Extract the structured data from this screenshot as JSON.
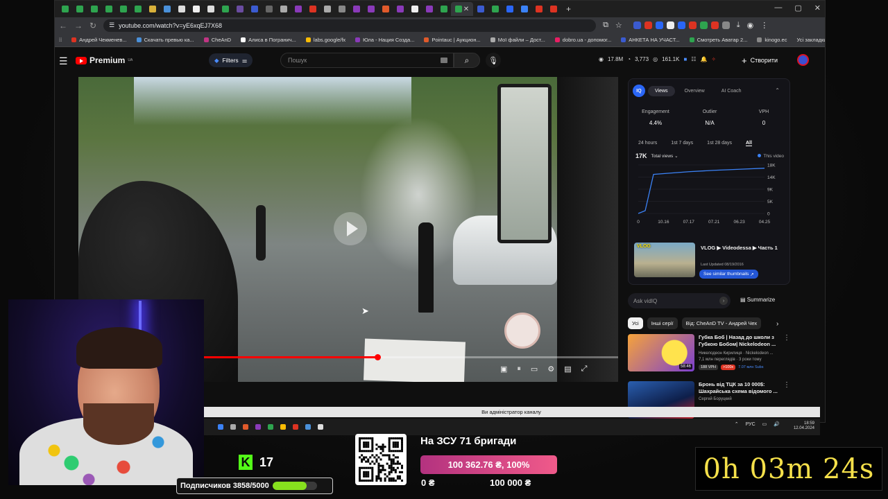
{
  "browser": {
    "url": "youtube.com/watch?v=yE6xqEJ7X68",
    "tabs": [
      {
        "color": "#2ea44f"
      },
      {
        "color": "#2ea44f"
      },
      {
        "color": "#2ea44f"
      },
      {
        "color": "#2ea44f"
      },
      {
        "color": "#2ea44f"
      },
      {
        "color": "#2ea44f"
      },
      {
        "color": "#d9b13a"
      },
      {
        "color": "#4a90d9"
      },
      {
        "color": "#ddd"
      },
      {
        "color": "#eee"
      },
      {
        "color": "#ddd"
      },
      {
        "color": "#2ea44f"
      },
      {
        "color": "#6a4ca0"
      },
      {
        "color": "#3b5bd0"
      },
      {
        "color": "#666"
      },
      {
        "color": "#aaa"
      },
      {
        "color": "#8a3ab9"
      },
      {
        "color": "#d32"
      },
      {
        "color": "#aaa"
      },
      {
        "color": "#888"
      },
      {
        "color": "#8a3ab9"
      },
      {
        "color": "#8a3ab9"
      },
      {
        "color": "#e05a2b"
      },
      {
        "color": "#8a3ab9"
      },
      {
        "color": "#eee"
      },
      {
        "color": "#8a3ab9"
      },
      {
        "color": "#2ea44f"
      },
      {
        "color": "#2ea44f"
      },
      {
        "color": "#3b5bd0"
      },
      {
        "color": "#2ea44f"
      },
      {
        "color": "#2a66f7"
      },
      {
        "color": "#3b82f6"
      },
      {
        "color": "#d32"
      },
      {
        "color": "#d32"
      }
    ],
    "bookmarks": [
      {
        "label": "Андрей Чекменев...",
        "color": "#d32"
      },
      {
        "label": "Скачать превью ка...",
        "color": "#4a90d9"
      },
      {
        "label": "CheAnD",
        "color": "#c13584"
      },
      {
        "label": "Алиса в Погранич...",
        "color": "#fff"
      },
      {
        "label": "labs.google/fx",
        "color": "#fbbc04"
      },
      {
        "label": "Юла - Нация Созда...",
        "color": "#8a3ab9"
      },
      {
        "label": "Pointauc | Аукцион...",
        "color": "#e05a2b"
      },
      {
        "label": "Мої файли – Дост...",
        "color": "#aaa"
      },
      {
        "label": "dobro.ua - допомог...",
        "color": "#e91e63"
      },
      {
        "label": "АНКЕТА НА УЧАСТ...",
        "color": "#3b5bd0"
      },
      {
        "label": "Смотреть Аватар 2...",
        "color": "#2ea44f"
      },
      {
        "label": "kinogo.ec",
        "color": "#888"
      }
    ],
    "all_bookmarks": "Усі закладки"
  },
  "youtube": {
    "logo_text": "Premium",
    "logo_region": "UA",
    "filters_label": "Filters",
    "search_placeholder": "Пошук",
    "stats": {
      "views": "17.8M",
      "likes": "3,773",
      "subs": "161.1K"
    },
    "create_label": "Створити"
  },
  "player": {
    "progress": 0.42
  },
  "vidiq": {
    "tabs": [
      "Views",
      "Overview",
      "AI Coach"
    ],
    "active_tab": "Views",
    "metrics": [
      {
        "label": "Engagement",
        "value": "4.4%"
      },
      {
        "label": "Outlier",
        "value": "N/A"
      },
      {
        "label": "VPH",
        "value": "0"
      }
    ],
    "ranges": [
      "24 hours",
      "1st 7 days",
      "1st 28 days",
      "All"
    ],
    "active_range": "All",
    "total_value": "17K",
    "total_select": "Total views",
    "legend_this": "This video",
    "video_title": "VLOG ▶ Videodessa ▶ Часть 1",
    "video_date": "Last Updated 08/19/2016",
    "thumb_tag": "VLOG",
    "similar_button": "See similar thumbnails",
    "ask_placeholder": "Ask vidIQ",
    "summarize": "Summarize"
  },
  "chart_data": {
    "type": "line",
    "x": [
      "0",
      "10.16",
      "07.17",
      "07.21",
      "06.23",
      "04.25"
    ],
    "ylim": [
      0,
      18000
    ],
    "yticks": [
      "18K",
      "14K",
      "9K",
      "5K",
      "0"
    ],
    "series": [
      {
        "name": "This video",
        "values": [
          0,
          14500,
          15500,
          16000,
          16400,
          16800
        ]
      }
    ]
  },
  "chips": [
    "Усі",
    "Інші серії",
    "Від: CheAnD TV - Андрей Чех"
  ],
  "recommendations": [
    {
      "title": "Губка Боб | Назад до школи з Губкою Бобом| Nickelodeon ...",
      "channel": "Никелодеон Кирилиця · Nickelodeon ...",
      "meta": "7,1 млн переглядів · 3 роки тому",
      "duration": "58:46",
      "vph": "188 VPH",
      "mult": ">100x",
      "subs": "7.07 млн Subs"
    },
    {
      "title": "Бронь від ТЦК за 10 000$: Шахрайська схема відомого ...",
      "channel": "Сергей Боруцкий",
      "meta": "",
      "duration": "",
      "vph": "",
      "mult": "",
      "subs": ""
    }
  ],
  "overlay": {
    "admin_notice": "Ви адміністратор каналу",
    "kick_count": "17",
    "subs_label": "Подписчиков 3858/5000",
    "subs_progress": 0.7716,
    "donation_title": "На ЗСУ 71 бригади",
    "donation_amount": "100 362.76 ₴, 100%",
    "donation_min": "0 ₴",
    "donation_max": "100 000 ₴",
    "timer": "0h 03m 24s"
  },
  "taskbar": {
    "lang": "РУС",
    "time": "18:59",
    "date": "12.04.2024"
  }
}
